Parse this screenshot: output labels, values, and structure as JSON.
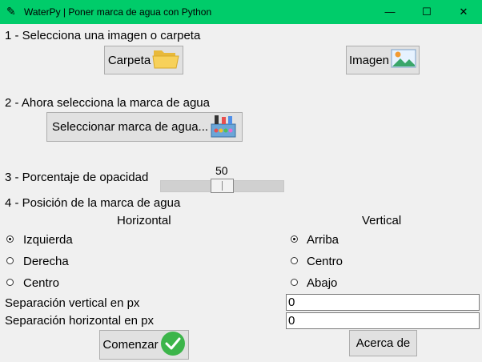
{
  "window": {
    "title": "WaterPy | Poner marca de agua con Python",
    "minimize": "—",
    "maximize": "☐",
    "close": "✕"
  },
  "step1": {
    "label": "1 - Selecciona una imagen o carpeta",
    "folder_button": "Carpeta",
    "image_button": "Imagen"
  },
  "step2": {
    "label": "2 - Ahora selecciona la marca de agua",
    "select_button": "Seleccionar marca de agua..."
  },
  "step3": {
    "label": "3 - Porcentaje de opacidad",
    "opacity_value": "50",
    "opacity_fraction": 0.5
  },
  "step4": {
    "label": "4 - Posición de la marca de agua",
    "horizontal_header": "Horizontal",
    "vertical_header": "Vertical",
    "horizontal_options": [
      "Izquierda",
      "Derecha",
      "Centro"
    ],
    "vertical_options": [
      "Arriba",
      "Centro",
      "Abajo"
    ],
    "horizontal_selected": "Izquierda",
    "vertical_selected": "Arriba"
  },
  "separation": {
    "vertical_label": "Separación vertical en px",
    "vertical_value": "0",
    "horizontal_label": "Separación horizontal en px",
    "horizontal_value": "0"
  },
  "actions": {
    "start_button": "Comenzar",
    "about_button": "Acerca de"
  },
  "colors": {
    "titlebar": "#00cc6a",
    "window_bg": "#f0f0f0",
    "check_green": "#3cb54a"
  }
}
